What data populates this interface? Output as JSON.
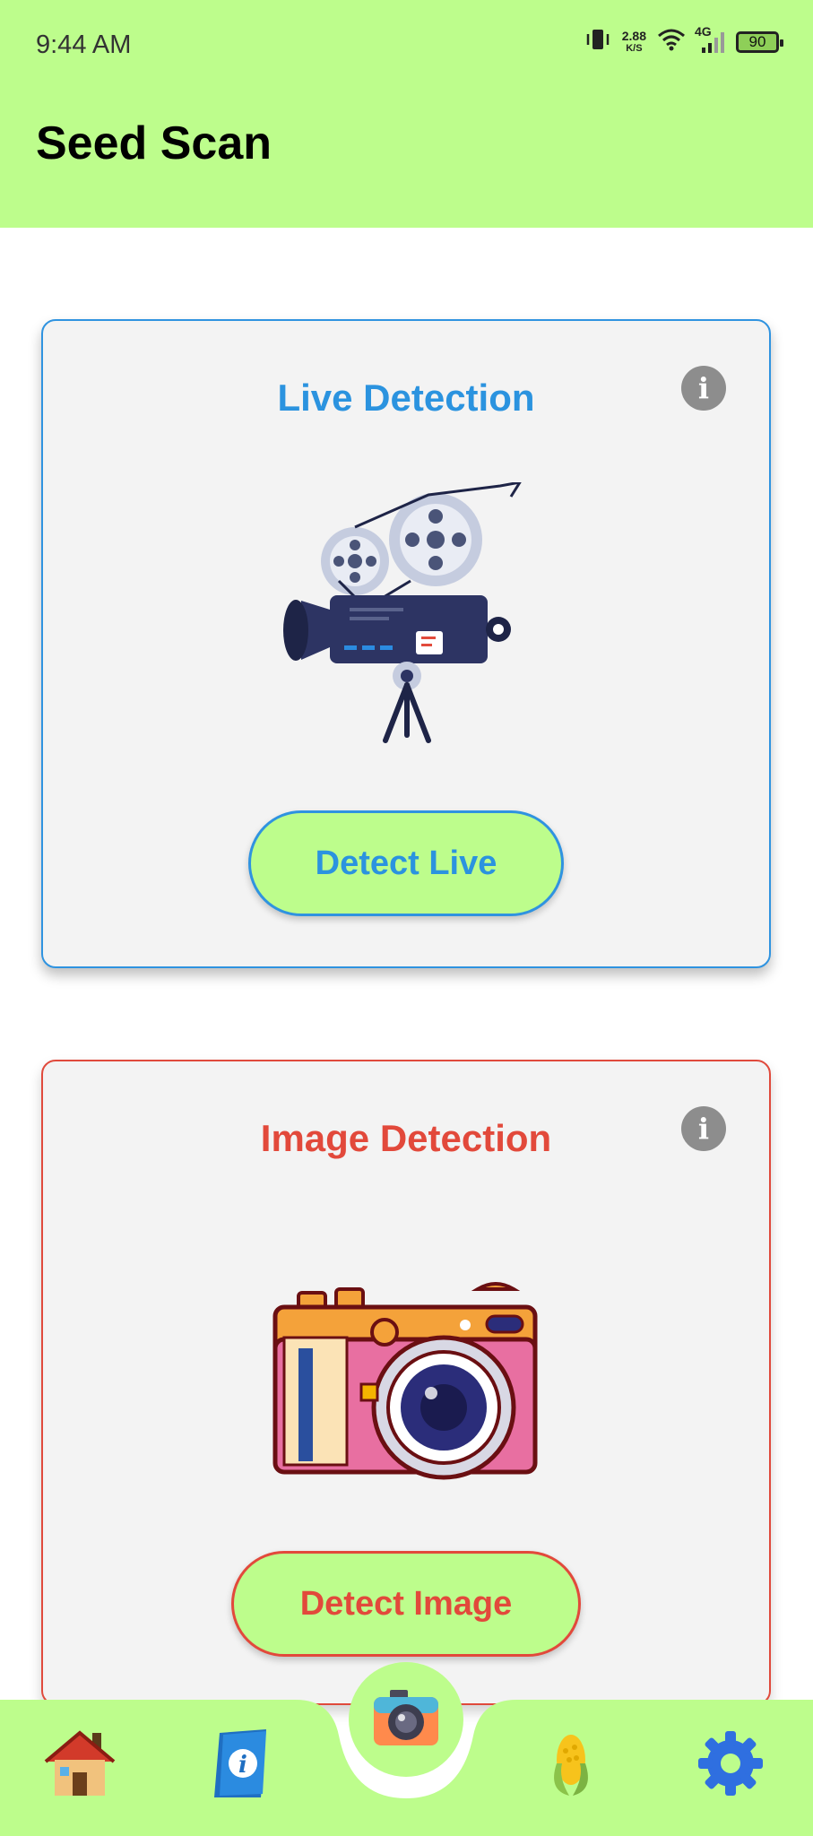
{
  "status_bar": {
    "time": "9:44 AM",
    "net_speed_value": "2.88",
    "net_speed_unit": "K/S",
    "network_type": "4G",
    "battery": "90",
    "icons": [
      "vibrate-icon",
      "wifi-icon",
      "signal-icon",
      "battery-icon"
    ]
  },
  "app_bar": {
    "title": "Seed Scan"
  },
  "cards": {
    "live": {
      "title": "Live Detection",
      "button_label": "Detect Live",
      "accent": "#2b93df",
      "illustration": "movie-camera-icon"
    },
    "image": {
      "title": "Image Detection",
      "button_label": "Detect Image",
      "accent": "#e2493b",
      "illustration": "photo-camera-icon"
    }
  },
  "bottom_nav": {
    "items": [
      "home-icon",
      "info-book-icon",
      "camera-icon",
      "corn-icon",
      "settings-gear-icon"
    ],
    "active": "camera-icon",
    "background": "#bdfd8c"
  },
  "colors": {
    "theme_green": "#bdfd8c",
    "card_bg": "#f3f3f3"
  }
}
